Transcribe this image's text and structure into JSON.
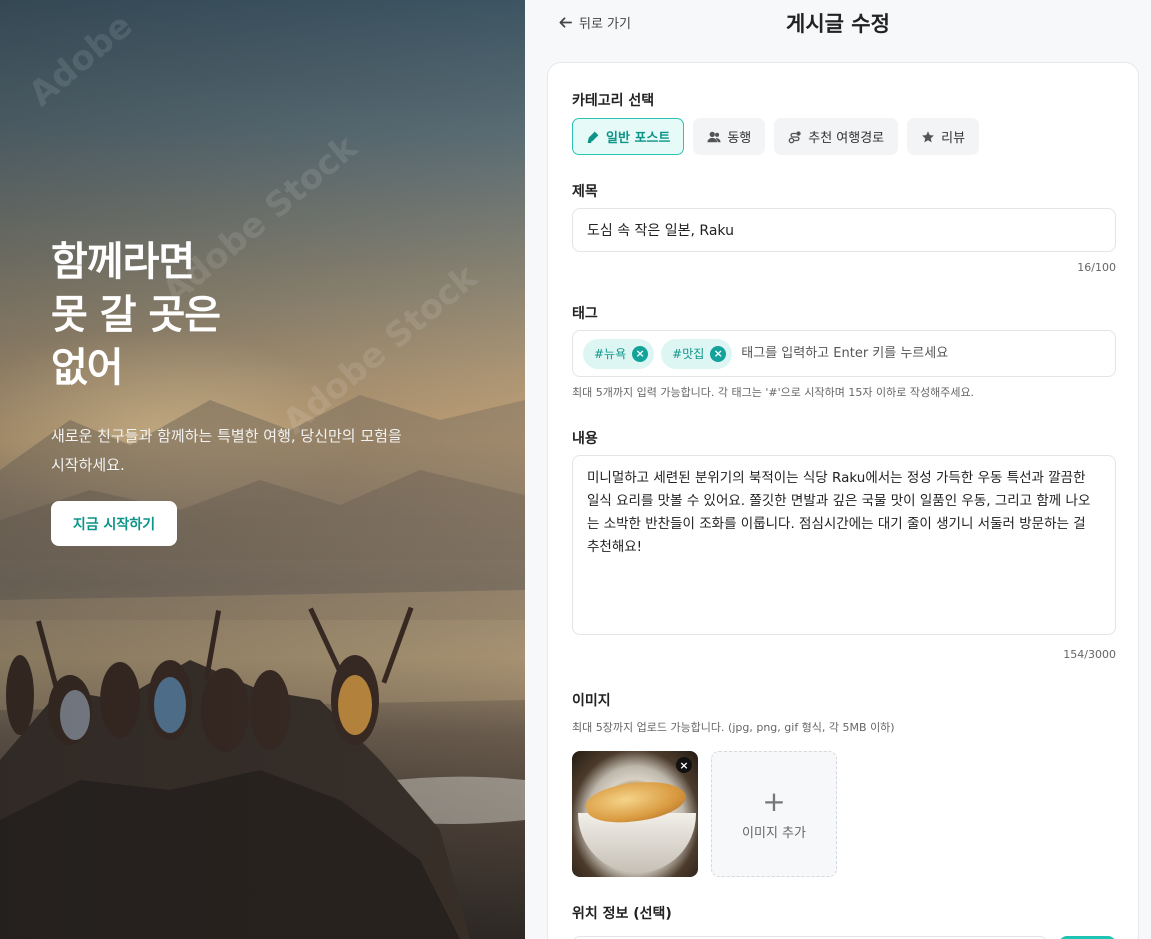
{
  "hero": {
    "title": "함께라면\n못 갈 곳은\n없어",
    "subtitle": "새로운 친구들과 함께하는 특별한 여행, 당신만의 모험을 시작하세요.",
    "cta_label": "지금 시작하기"
  },
  "header": {
    "back_label": "뒤로 가기",
    "title": "게시글 수정"
  },
  "form": {
    "category": {
      "label": "카테고리 선택",
      "options": [
        {
          "label": "일반 포스트",
          "icon": "pen-icon",
          "active": true
        },
        {
          "label": "동행",
          "icon": "users-icon",
          "active": false
        },
        {
          "label": "추천 여행경로",
          "icon": "route-icon",
          "active": false
        },
        {
          "label": "리뷰",
          "icon": "star-icon",
          "active": false
        }
      ]
    },
    "title": {
      "label": "제목",
      "value": "도심 속 작은 일본, Raku",
      "counter": "16/100"
    },
    "tags": {
      "label": "태그",
      "items": [
        "#뉴욕",
        "#맛집"
      ],
      "placeholder": "태그를 입력하고 Enter 키를 누르세요",
      "hint": "최대 5개까지 입력 가능합니다. 각 태그는 '#'으로 시작하며 15자 이하로 작성해주세요."
    },
    "content": {
      "label": "내용",
      "value": "미니멀하고 세련된 분위기의 북적이는 식당 Raku에서는 정성 가득한 우동 특선과 깔끔한 일식 요리를 맛볼 수 있어요. 쫄깃한 면발과 깊은 국물 맛이 일품인 우동, 그리고 함께 나오는 소박한 반찬들이 조화를 이룹니다. 점심시간에는 대기 줄이 생기니 서둘러 방문하는 걸 추천해요!",
      "counter": "154/3000"
    },
    "images": {
      "label": "이미지",
      "hint": "최대 5장까지 업로드 가능합니다. (jpg, png, gif 형식, 각 5MB 이하)",
      "add_label": "이미지 추가",
      "remove_glyph": "×",
      "plus_glyph": "+"
    },
    "location": {
      "label": "위치 정보 (선택)"
    }
  },
  "colors": {
    "accent": "#0d9488",
    "accent_light": "#e6fbf8",
    "accent_button": "#20c4b3"
  }
}
